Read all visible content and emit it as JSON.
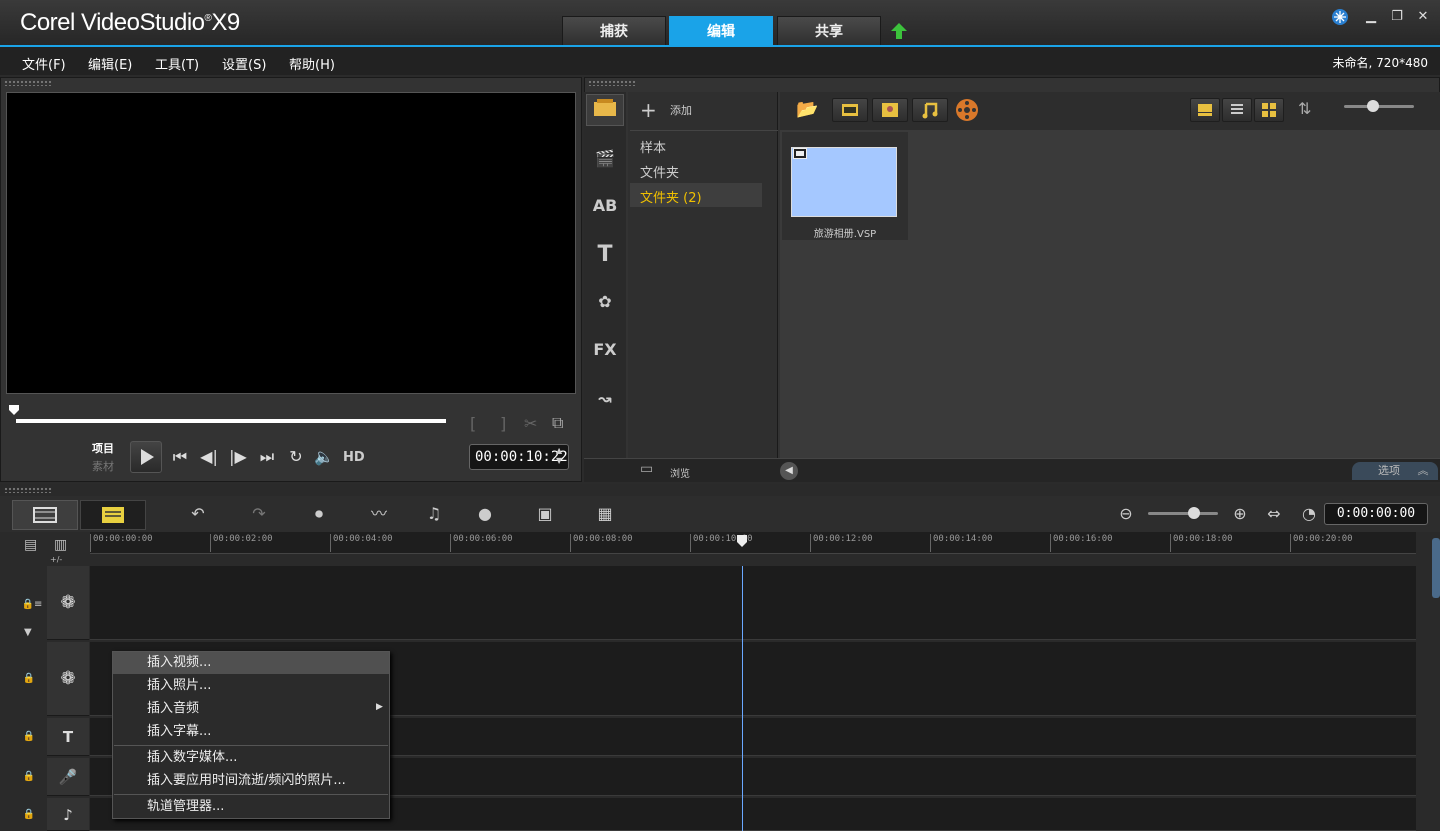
{
  "window": {
    "title_brand": "Corel VideoStudio",
    "title_version": "X9",
    "project_info": "未命名, 720*480"
  },
  "mode_tabs": [
    {
      "label": "捕获"
    },
    {
      "label": "编辑"
    },
    {
      "label": "共享"
    }
  ],
  "menu": [
    "文件(F)",
    "编辑(E)",
    "工具(T)",
    "设置(S)",
    "帮助(H)"
  ],
  "player": {
    "mode_project": "项目",
    "mode_clip": "素材",
    "hd_label": "HD",
    "timecode": "00:00:10:22",
    "mark_in": "[",
    "mark_out": "]"
  },
  "library": {
    "add_label": "添加",
    "tree": [
      "样本",
      "文件夹",
      "文件夹 (2)"
    ],
    "items": [
      {
        "caption": "旅游相册.VSP"
      }
    ],
    "browse_label": "浏览",
    "options_label": "选项",
    "sidebar_fx": "FX",
    "sidebar_ab": "AB",
    "sidebar_t": "T"
  },
  "timeline": {
    "timecode": "0:00:00:00",
    "ruler": [
      "00:00:00:00",
      "00:00:02:00",
      "00:00:04:00",
      "00:00:06:00",
      "00:00:08:00",
      "00:00:10:00",
      "00:00:12:00",
      "00:00:14:00",
      "00:00:16:00",
      "00:00:18:00",
      "00:00:20:00"
    ],
    "track_toggle": "+/-"
  },
  "context_menu": [
    "插入视频...",
    "插入照片...",
    "插入音频",
    "插入字幕...",
    "插入数字媒体...",
    "插入要应用时间流逝/频闪的照片...",
    "轨道管理器..."
  ]
}
